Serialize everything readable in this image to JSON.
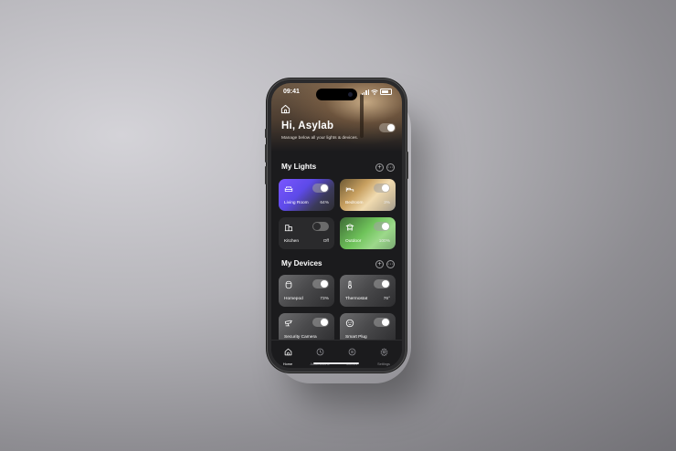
{
  "status": {
    "time": "09:41"
  },
  "hero": {
    "greeting": "Hi, Asylab",
    "subtitle": "Manage below all your lights & devices.",
    "master_toggle": "on"
  },
  "lights": {
    "title": "My Lights",
    "items": [
      {
        "name": "Living Room",
        "value": "64%",
        "icon": "sofa-icon",
        "state": "on"
      },
      {
        "name": "Bedroom",
        "value": "3%",
        "icon": "bed-icon",
        "state": "on"
      },
      {
        "name": "Kitchen",
        "value": "Off",
        "icon": "kitchen-icon",
        "state": "off"
      },
      {
        "name": "Outdoor",
        "value": "100%",
        "icon": "outdoor-icon",
        "state": "on"
      }
    ]
  },
  "devices": {
    "title": "My Devices",
    "items": [
      {
        "name": "Homepod",
        "value": "73%",
        "icon": "speaker-icon",
        "state": "on"
      },
      {
        "name": "Thermostat",
        "value": "76°",
        "icon": "thermometer-icon",
        "state": "on"
      },
      {
        "name": "Security Camera",
        "value": "",
        "icon": "camera-icon",
        "state": "on"
      },
      {
        "name": "Smart Plug",
        "value": "",
        "icon": "plug-icon",
        "state": "on"
      }
    ]
  },
  "tabs": [
    {
      "label": "Home",
      "icon": "home-icon",
      "active": true
    },
    {
      "label": "Automations",
      "icon": "clock-icon",
      "active": false
    },
    {
      "label": "Scenes",
      "icon": "list-icon",
      "active": false
    },
    {
      "label": "Settings",
      "icon": "gear-icon",
      "active": false
    }
  ]
}
